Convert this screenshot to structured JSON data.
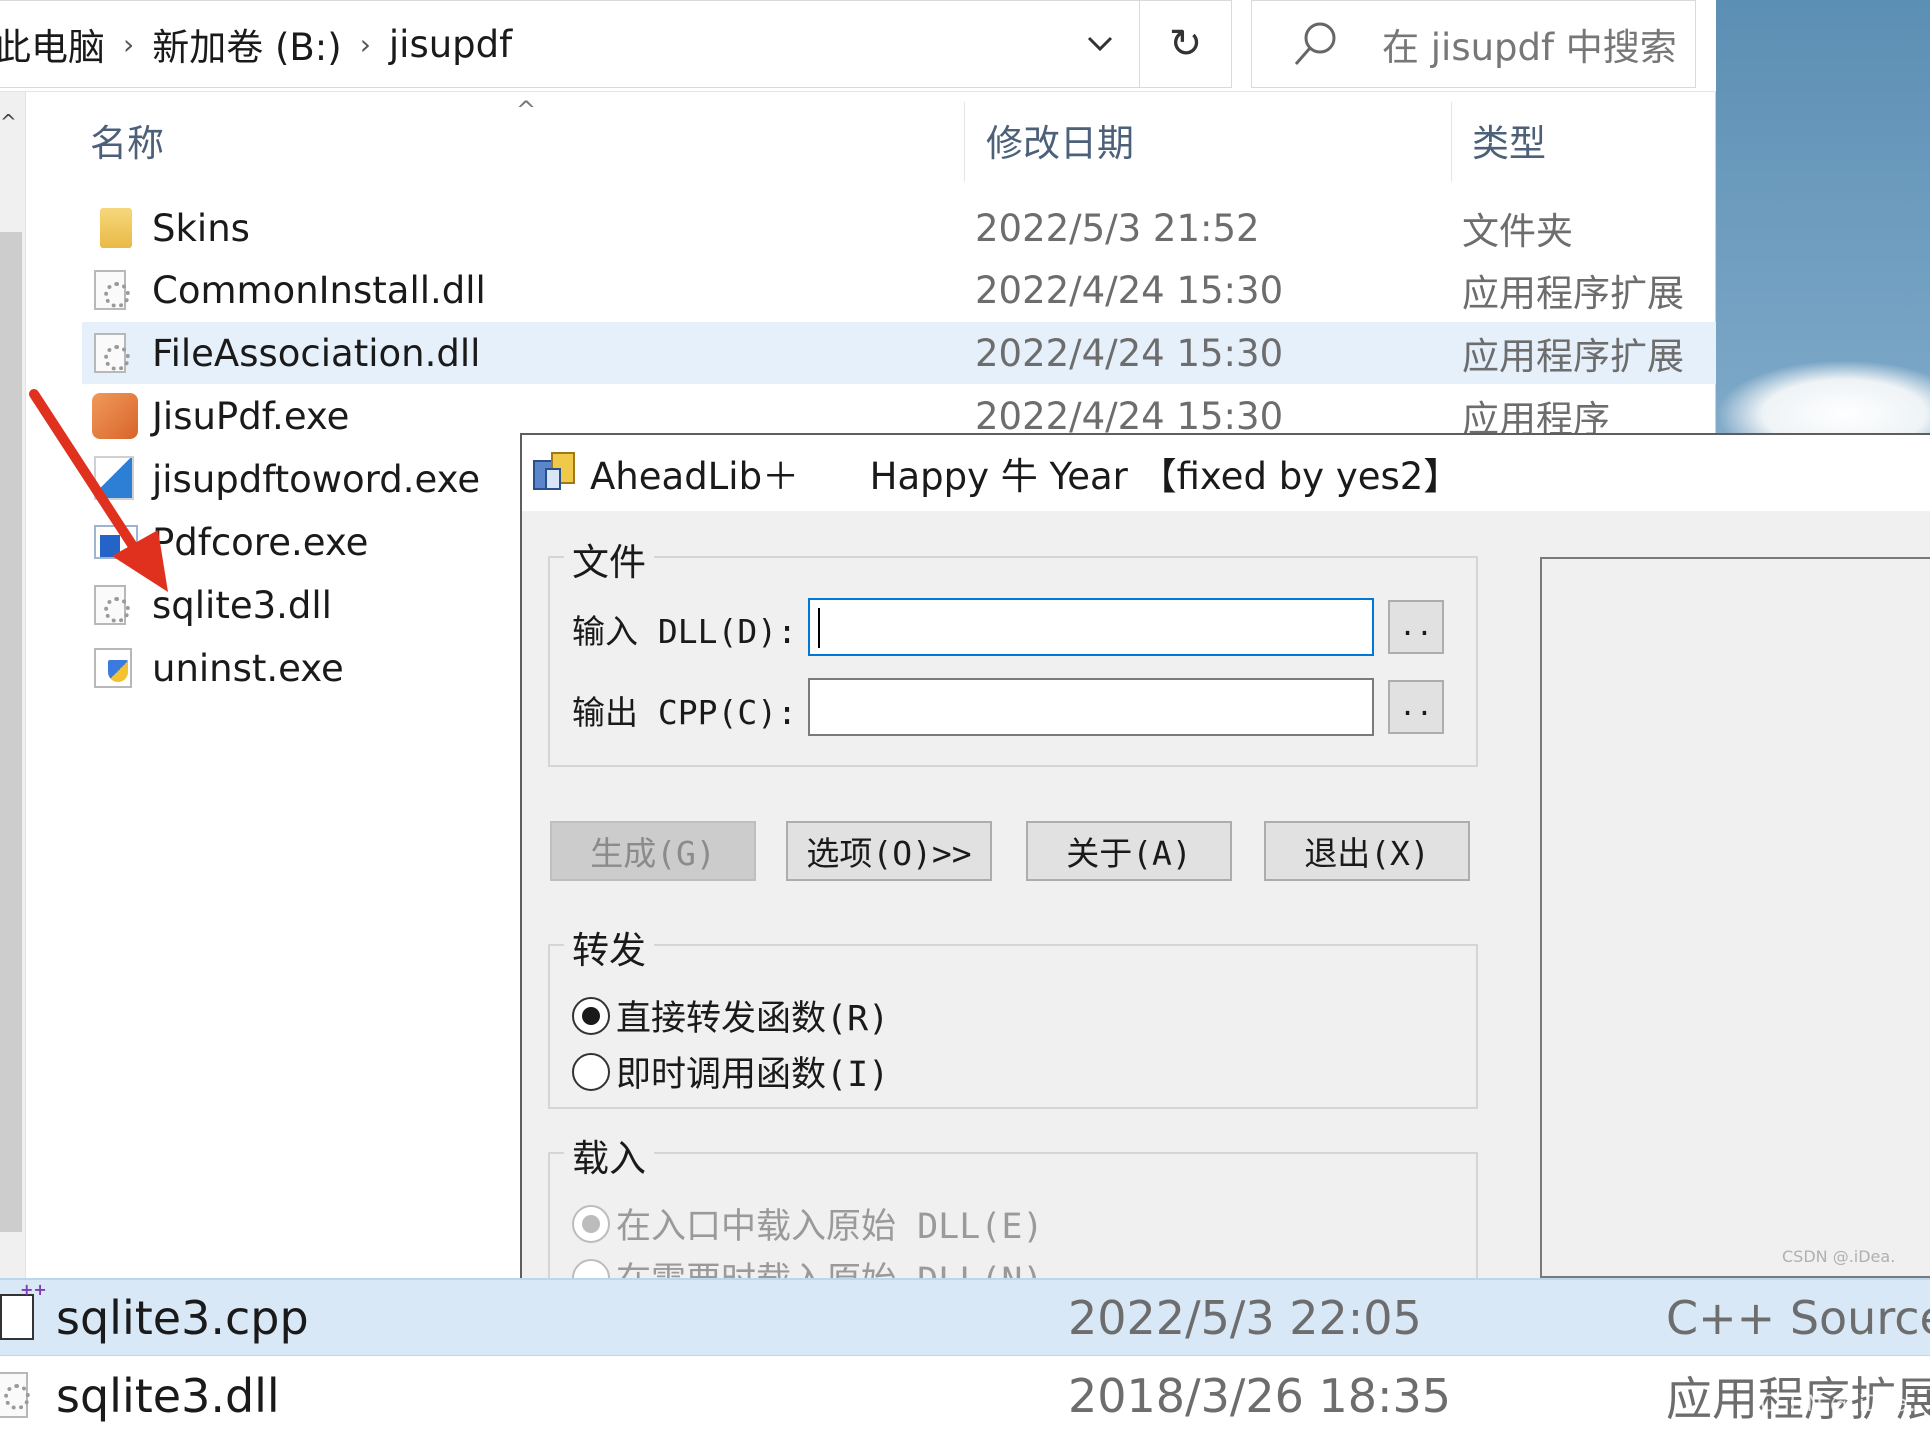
{
  "breadcrumb": [
    "此电脑",
    "新加卷 (B:)",
    "jisupdf"
  ],
  "search": {
    "placeholder": "在 jisupdf 中搜索"
  },
  "columns": {
    "name": "名称",
    "date": "修改日期",
    "type": "类型"
  },
  "files": [
    {
      "name": "Skins",
      "date": "2022/5/3 21:52",
      "type": "文件夹",
      "icon": "folder-icon",
      "selected": false
    },
    {
      "name": "CommonInstall.dll",
      "date": "2022/4/24 15:30",
      "type": "应用程序扩展",
      "icon": "dll-file-icon",
      "selected": false
    },
    {
      "name": "FileAssociation.dll",
      "date": "2022/4/24 15:30",
      "type": "应用程序扩展",
      "icon": "dll-file-icon",
      "selected": true
    },
    {
      "name": "JisuPdf.exe",
      "date": "2022/4/24 15:30",
      "type": "应用程序",
      "icon": "pdf-app-icon",
      "selected": false
    },
    {
      "name": "jisupdftoword.exe",
      "date": "",
      "type": "",
      "icon": "pdf-to-word-icon",
      "selected": false
    },
    {
      "name": "Pdfcore.exe",
      "date": "",
      "type": "",
      "icon": "pdfcore-icon",
      "selected": false
    },
    {
      "name": "sqlite3.dll",
      "date": "",
      "type": "",
      "icon": "dll-file-icon",
      "selected": false
    },
    {
      "name": "uninst.exe",
      "date": "",
      "type": "",
      "icon": "uninstall-icon",
      "selected": false
    }
  ],
  "dialog": {
    "title": "AheadLib＋      Happy 牛 Year 【fixed by yes2】",
    "file_group": "文件",
    "input_dll_label": "输入 DLL(D):",
    "output_cpp_label": "输出 CPP(C):",
    "input_dll_value": "",
    "output_cpp_value": "",
    "browse_label": "..",
    "buttons": {
      "generate": "生成(G)",
      "options": "选项(O)>>",
      "about": "关于(A)",
      "exit": "退出(X)"
    },
    "forward_group": "转发",
    "forward_options": [
      {
        "label": "直接转发函数(R)",
        "checked": true
      },
      {
        "label": "即时调用函数(I)",
        "checked": false
      }
    ],
    "load_group": "载入",
    "load_options": [
      {
        "label": "在入口中载入原始 DLL(E)",
        "checked": true
      },
      {
        "label": "在需要时载入原始 DLL(N)",
        "checked": false
      }
    ]
  },
  "bottom_files": [
    {
      "name": "sqlite3.cpp",
      "date": "2022/5/3 22:05",
      "type": "C++ Source",
      "icon": "cpp-file-icon"
    },
    {
      "name": "sqlite3.dll",
      "date": "2018/3/26 18:35",
      "type": "应用程序扩展",
      "icon": "dll-file-icon"
    }
  ],
  "watermark": "CSDN @.iDea."
}
